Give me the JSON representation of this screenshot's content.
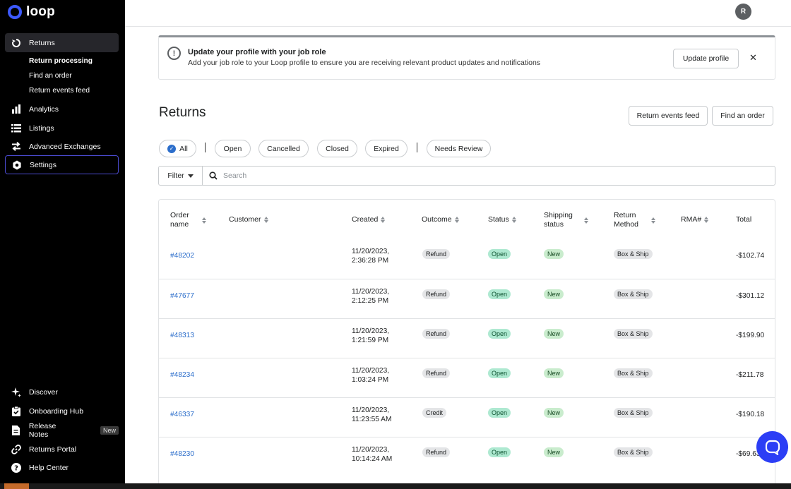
{
  "app": {
    "logo_text": "loop"
  },
  "sidebar": {
    "returns": "Returns",
    "sub_items": [
      "Return processing",
      "Find an order",
      "Return events feed"
    ],
    "analytics": "Analytics",
    "listings": "Listings",
    "advanced_exchanges": "Advanced Exchanges",
    "settings": "Settings",
    "bottom": {
      "discover": "Discover",
      "onboarding_hub": "Onboarding Hub",
      "release_notes": "Release Notes",
      "new_badge": "New",
      "returns_portal": "Returns Portal",
      "help_center": "Help Center"
    }
  },
  "topbar": {
    "avatar_initial": "R"
  },
  "banner": {
    "title": "Update your profile with your job role",
    "text": "Add your job role to your Loop profile to ensure you are receiving relevant product updates and notifications",
    "button": "Update profile",
    "close": "✕"
  },
  "page": {
    "title": "Returns",
    "btn_events": "Return events feed",
    "btn_find": "Find an order"
  },
  "chips": [
    "All",
    "Open",
    "Cancelled",
    "Closed",
    "Expired",
    "Needs Review"
  ],
  "filter": {
    "label": "Filter",
    "search_placeholder": "Search"
  },
  "table": {
    "headers": {
      "order_name": "Order\nname",
      "customer": "Customer",
      "created": "Created",
      "outcome": "Outcome",
      "status": "Status",
      "shipping_status": "Shipping\nstatus",
      "return_method": "Return\nMethod",
      "rma": "RMA#",
      "total": "Total"
    },
    "rows": [
      {
        "order": "#48202",
        "created_date": "11/20/2023,",
        "created_time": "2:36:28 PM",
        "outcome": "Refund",
        "status": "Open",
        "shipping": "New",
        "method": "Box & Ship",
        "total": "-$102.74"
      },
      {
        "order": "#47677",
        "created_date": "11/20/2023,",
        "created_time": "2:12:25 PM",
        "outcome": "Refund",
        "status": "Open",
        "shipping": "New",
        "method": "Box & Ship",
        "total": "-$301.12"
      },
      {
        "order": "#48313",
        "created_date": "11/20/2023,",
        "created_time": "1:21:59 PM",
        "outcome": "Refund",
        "status": "Open",
        "shipping": "New",
        "method": "Box & Ship",
        "total": "-$199.90"
      },
      {
        "order": "#48234",
        "created_date": "11/20/2023,",
        "created_time": "1:03:24 PM",
        "outcome": "Refund",
        "status": "Open",
        "shipping": "New",
        "method": "Box & Ship",
        "total": "-$211.78"
      },
      {
        "order": "#46337",
        "created_date": "11/20/2023,",
        "created_time": "11:23:55 AM",
        "outcome": "Credit",
        "status": "Open",
        "shipping": "New",
        "method": "Box & Ship",
        "total": "-$190.18"
      },
      {
        "order": "#48230",
        "created_date": "11/20/2023,",
        "created_time": "10:14:24 AM",
        "outcome": "Refund",
        "status": "Open",
        "shipping": "New",
        "method": "Box & Ship",
        "total": "-$69.63"
      }
    ]
  },
  "colors": {
    "accent": "#2c6ecb",
    "sidebar_bg": "#000000",
    "chat_fab": "#2c3ef5"
  }
}
